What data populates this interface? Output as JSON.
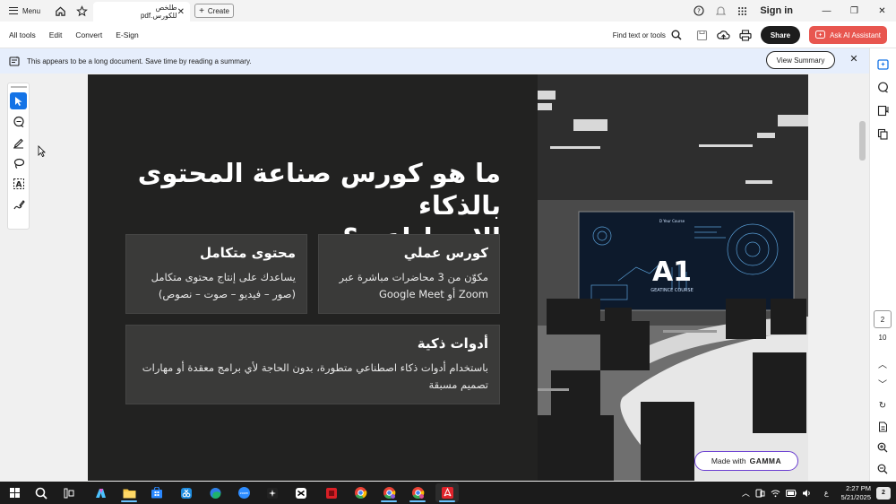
{
  "tabbar": {
    "menu_label": "Menu",
    "doc_tab_title": "طلخص للكورس.pdf",
    "create_label": "Create",
    "signin_label": "Sign in"
  },
  "toolbar": {
    "items": [
      "All tools",
      "Edit",
      "Convert",
      "E-Sign"
    ],
    "find_label": "Find text or tools",
    "share_label": "Share",
    "ai_label": "Ask AI Assistant"
  },
  "banner": {
    "text": "This appears to be a long document. Save time by reading a summary.",
    "button_label": "View Summary"
  },
  "slide": {
    "title_line1": "ما هو كورس صناعة المحتوى بالذكاء",
    "title_line2": "الاصطناعي؟",
    "cards": [
      {
        "title": "كورس عملي",
        "body": "مكوّن من 3 محاضرات مباشرة عبر Zoom أو Google Meet"
      },
      {
        "title": "محتوى متكامل",
        "body": "يساعدك على إنتاج محتوى متكامل (صور – فيديو – صوت – نصوص)"
      },
      {
        "title": "أدوات ذكية",
        "body": "باستخدام أدوات ذكاء اصطناعي متطورة، بدون الحاجة لأي برامج معقدة أو مهارات تصميم مسبقة"
      }
    ],
    "screen_big_text": "A1",
    "screen_small_text": "GEATINCE COURSE",
    "screen_top_text": "D Yeur Course",
    "made_with_label": "Made with",
    "made_with_brand": "GAMMA"
  },
  "pagination": {
    "current_page": "2",
    "total_pages": "10"
  },
  "taskbar": {
    "time": "2:27 PM",
    "date": "5/21/2025",
    "lang": "ع",
    "notifications": "2"
  },
  "colors": {
    "accent": "#1473e6",
    "ai_button": "#e8564f",
    "slide_bg": "#222221",
    "card_bg": "#3a3a39"
  }
}
